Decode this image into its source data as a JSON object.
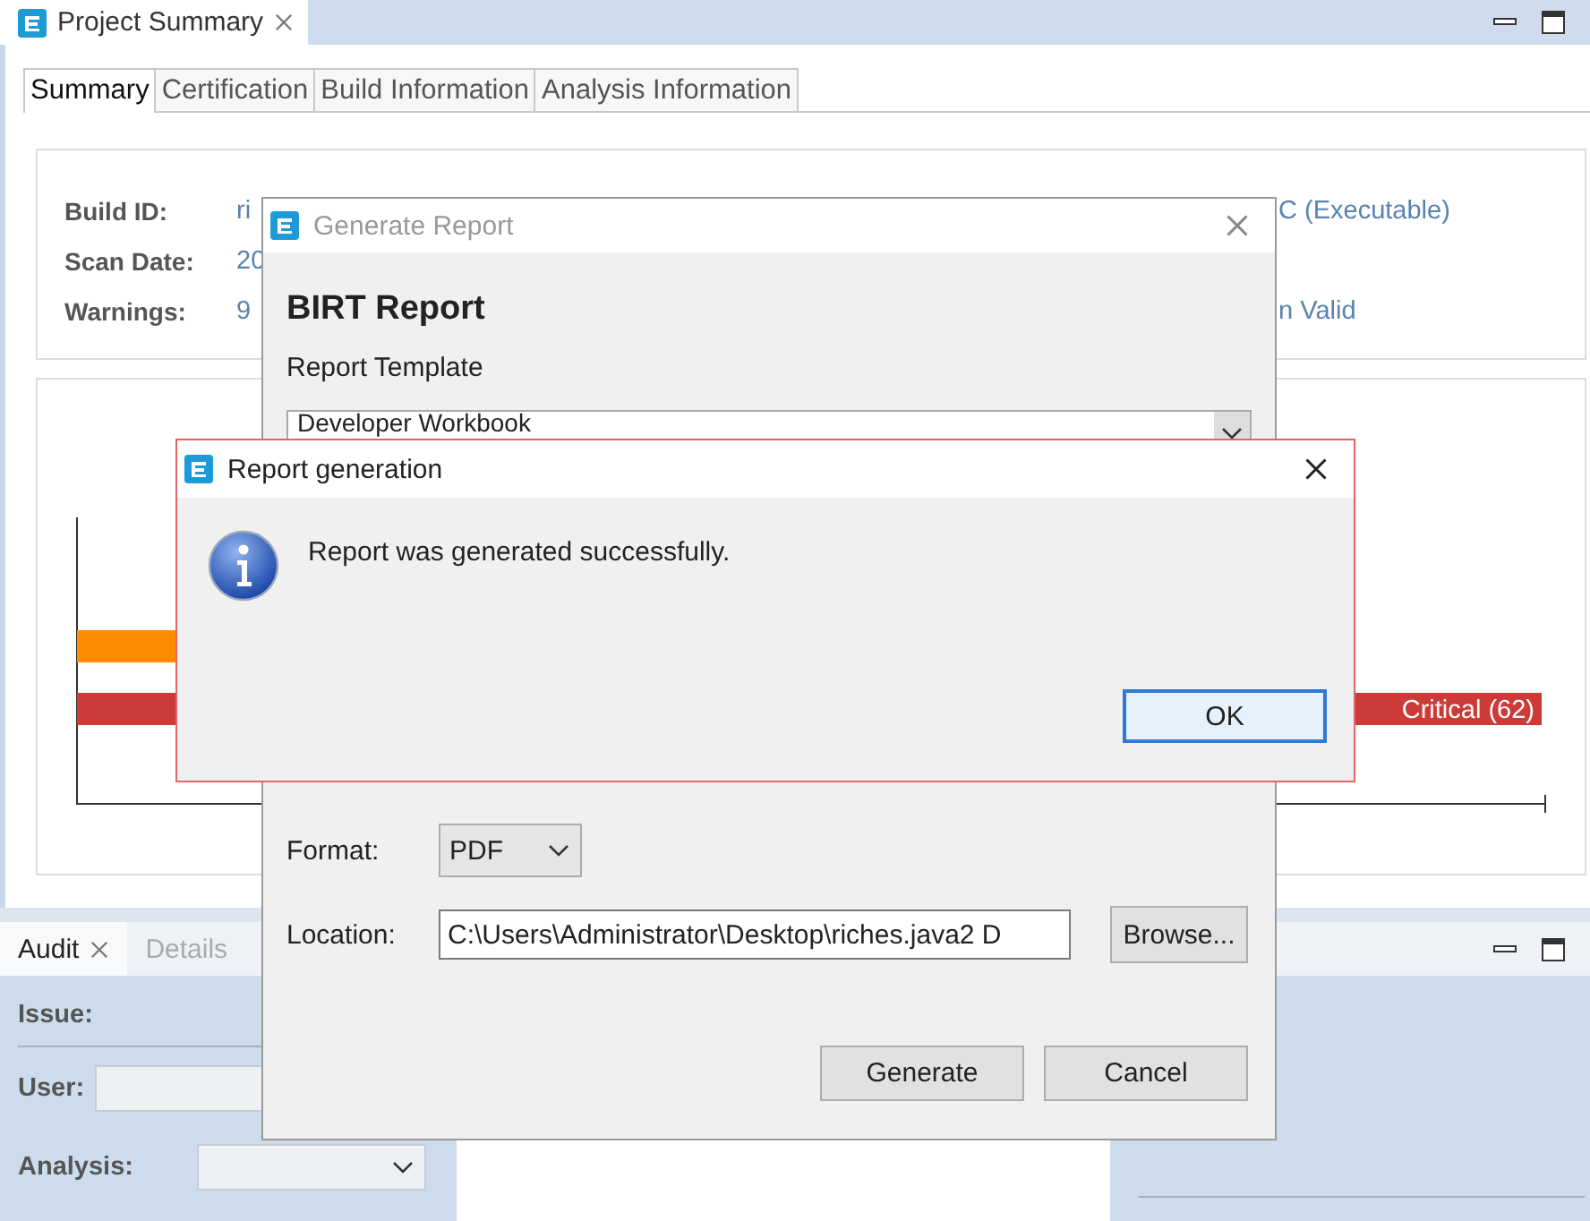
{
  "summary_view": {
    "title": "Project Summary",
    "selected": true,
    "tabs": [
      {
        "label": "Summary",
        "selected": true
      },
      {
        "label": "Certification",
        "selected": false
      },
      {
        "label": "Build Information",
        "selected": false
      },
      {
        "label": "Analysis Information",
        "selected": false
      }
    ],
    "info": [
      {
        "label": "Build ID:",
        "value": "ri",
        "value_right": "C (Executable)"
      },
      {
        "label": "Scan Date:",
        "value": "20"
      },
      {
        "label": "Warnings:",
        "value": "9",
        "value_right": "n Valid"
      }
    ],
    "chart": {
      "bars": [
        {
          "color": "#ff8c00"
        },
        {
          "color": "#cc3b37",
          "label": "Critical (62)"
        }
      ]
    }
  },
  "audit_view": {
    "tabs": [
      {
        "label": "Audit",
        "selected": true
      },
      {
        "label": "Details",
        "selected": false
      }
    ],
    "fields": [
      {
        "kind": "heading",
        "label": "Issue:"
      },
      {
        "kind": "text",
        "label": "User:"
      },
      {
        "kind": "dropdown",
        "label": "Analysis:"
      }
    ]
  },
  "generate_dialog": {
    "title": "Generate Report",
    "active": false,
    "heading": "BIRT Report",
    "template_label": "Report Template",
    "template_value": "Developer Workbook",
    "format_label": "Format:",
    "format_value": "PDF",
    "location_label": "Location:",
    "location_value": "C:\\Users\\Administrator\\Desktop\\riches.java2 D",
    "browse": "Browse...",
    "buttons": [
      "Generate",
      "Cancel"
    ]
  },
  "message_dialog": {
    "title": "Report generation",
    "active": true,
    "message": "Report was generated successfully.",
    "ok": "OK"
  }
}
